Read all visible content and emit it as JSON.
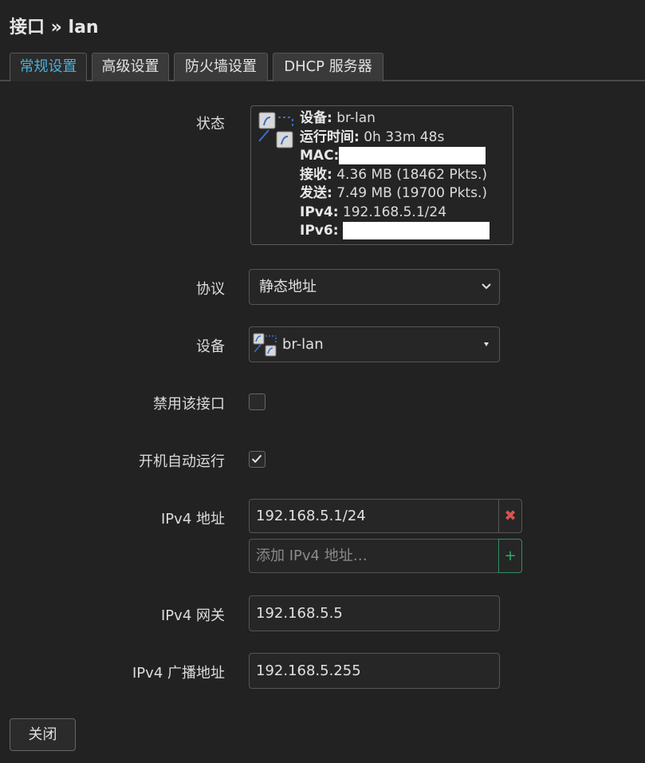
{
  "page": {
    "title": "接口 » lan"
  },
  "tabs": [
    {
      "label": "常规设置",
      "active": true
    },
    {
      "label": "高级设置",
      "active": false
    },
    {
      "label": "防火墙设置",
      "active": false
    },
    {
      "label": "DHCP 服务器",
      "active": false
    }
  ],
  "status": {
    "label": "状态",
    "device_key": "设备:",
    "device_value": "br-lan",
    "uptime_key": "运行时间:",
    "uptime_value": "0h 33m 48s",
    "mac_key": "MAC:",
    "rx_key": "接收:",
    "rx_value": "4.36 MB (18462 Pkts.)",
    "tx_key": "发送:",
    "tx_value": "7.49 MB (19700 Pkts.)",
    "ipv4_key": "IPv4:",
    "ipv4_value": "192.168.5.1/24",
    "ipv6_key": "IPv6:"
  },
  "protocol": {
    "label": "协议",
    "value": "静态地址"
  },
  "device": {
    "label": "设备",
    "value": "br-lan"
  },
  "disable_iface": {
    "label": "禁用该接口",
    "checked": false
  },
  "autostart": {
    "label": "开机自动运行",
    "checked": true
  },
  "ipv4_addr": {
    "label": "IPv4 地址",
    "value": "192.168.5.1/24",
    "remove_symbol": "✖",
    "placeholder": "添加 IPv4 地址…",
    "add_symbol": "+"
  },
  "ipv4_gateway": {
    "label": "IPv4 网关",
    "value": "192.168.5.5"
  },
  "ipv4_broadcast": {
    "label": "IPv4 广播地址",
    "value": "192.168.5.255"
  },
  "footer": {
    "close_label": "关闭"
  },
  "colors": {
    "accent": "#4ab0dc",
    "remove": "#d9534f",
    "add": "#2fae6f",
    "background": "#222222"
  }
}
